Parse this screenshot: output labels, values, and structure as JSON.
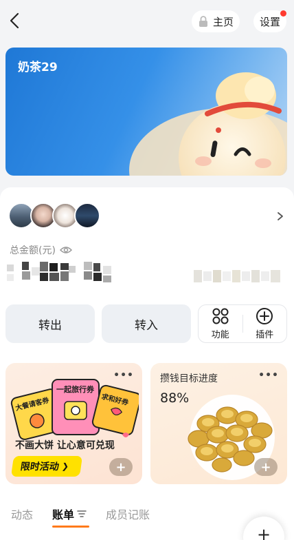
{
  "header": {
    "home_label": "主页",
    "settings_label": "设置"
  },
  "banner": {
    "title": "奶茶29"
  },
  "account": {
    "total_label": "总金额(元)"
  },
  "actions": {
    "transfer_out": "转出",
    "transfer_in": "转入",
    "features": "功能",
    "plugins": "插件"
  },
  "promo_card": {
    "tickets": [
      "大餐请客券",
      "一起旅行券",
      "求和好券"
    ],
    "text": "不画大饼  让心意可兑现",
    "badge": "限时活动",
    "badge_arrow": "❯"
  },
  "goal_card": {
    "title": "攒钱目标进度",
    "progress": "88%"
  },
  "tabs": {
    "items": [
      "动态",
      "账单",
      "成员记账"
    ],
    "active": "账单"
  },
  "colors": {
    "accent": "#ff7a1a",
    "banner_blue": "#2a85e0",
    "badge_yellow": "#ffe100",
    "red_dot": "#ff3b30"
  },
  "icons": {
    "back": "chevron-left-icon",
    "lock": "lock-icon",
    "eye": "eye-icon",
    "features": "four-circles-icon",
    "plugins": "plus-circle-icon",
    "more": "more-dots-icon",
    "filter": "filter-lines-icon"
  }
}
